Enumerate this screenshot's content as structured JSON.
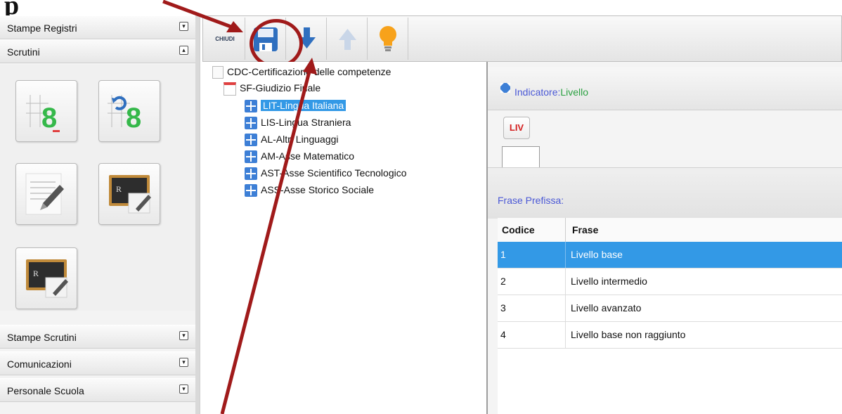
{
  "sidebar": {
    "headers": [
      {
        "label": "Stampe Registri",
        "toggle": "▾"
      },
      {
        "label": "Scrutini",
        "toggle": "▴"
      },
      {
        "label": "Stampe Scrutini",
        "toggle": "▾"
      },
      {
        "label": "Comunicazioni",
        "toggle": "▾"
      },
      {
        "label": "Personale Scuola",
        "toggle": "▾"
      }
    ],
    "tile_digit": "8"
  },
  "toolbar": {
    "close_label": "CHIUDI"
  },
  "tree": {
    "root": "CDC-Certificazione delle competenze",
    "group": "SF-Giudizio Finale",
    "items": [
      "LIT-Lingua Italiana",
      "LIS-Lingua Straniera",
      "AL-Altri Linguaggi",
      "AM-Asse Matematico",
      "AST-Asse Scientifico Tecnologico",
      "ASS-Asse Storico Sociale"
    ]
  },
  "right": {
    "indicator_label": "Indicatore:",
    "indicator_value": "Livello",
    "liv_button": "LIV",
    "prefissa_label": "Frase Prefissa:",
    "grid": {
      "headers": [
        "Codice",
        "Frase"
      ],
      "rows": [
        [
          "1",
          "Livello base"
        ],
        [
          "2",
          "Livello intermedio"
        ],
        [
          "3",
          "Livello avanzato"
        ],
        [
          "4",
          "Livello base non raggiunto"
        ]
      ]
    }
  },
  "colors": {
    "accent": "#3399e6",
    "annotation": "#a01a1a",
    "indicator": "#4a58d6"
  }
}
